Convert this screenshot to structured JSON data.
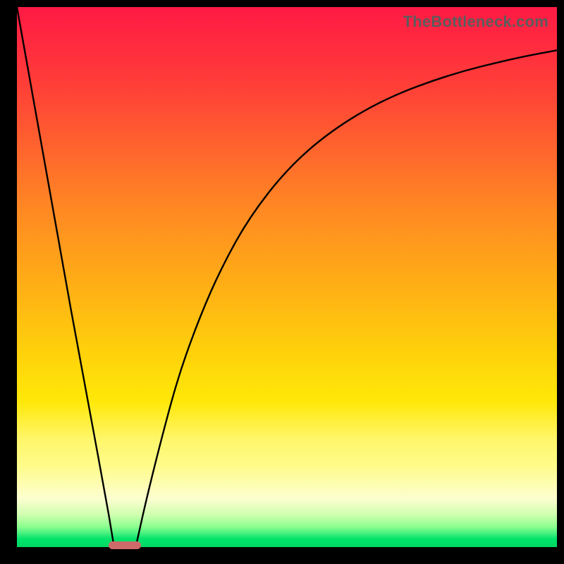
{
  "watermark": "TheBottleneck.com",
  "colors": {
    "frame": "#000000",
    "pill": "#cf6a6a",
    "curve": "#000000"
  },
  "chart_data": {
    "type": "line",
    "title": "",
    "xlabel": "",
    "ylabel": "",
    "xlim": [
      0,
      100
    ],
    "ylim": [
      0,
      100
    ],
    "grid": false,
    "legend": false,
    "series": [
      {
        "name": "left-branch",
        "x": [
          0,
          5,
          10,
          15,
          17,
          18
        ],
        "y": [
          100,
          72,
          44,
          17,
          6,
          0
        ]
      },
      {
        "name": "right-branch",
        "x": [
          22,
          24,
          27,
          30,
          34,
          38,
          43,
          50,
          58,
          68,
          80,
          92,
          100
        ],
        "y": [
          0,
          9,
          21,
          32,
          43,
          52,
          61,
          70,
          77,
          83,
          87.5,
          90.5,
          92
        ]
      }
    ],
    "marker": {
      "name": "optimal-point",
      "x_range": [
        17,
        23
      ],
      "y": 0
    },
    "gradient_stops": [
      {
        "pos": 0,
        "color": "#ff1a44"
      },
      {
        "pos": 50,
        "color": "#ffb015"
      },
      {
        "pos": 80,
        "color": "#fff66a"
      },
      {
        "pos": 100,
        "color": "#00d862"
      }
    ]
  }
}
